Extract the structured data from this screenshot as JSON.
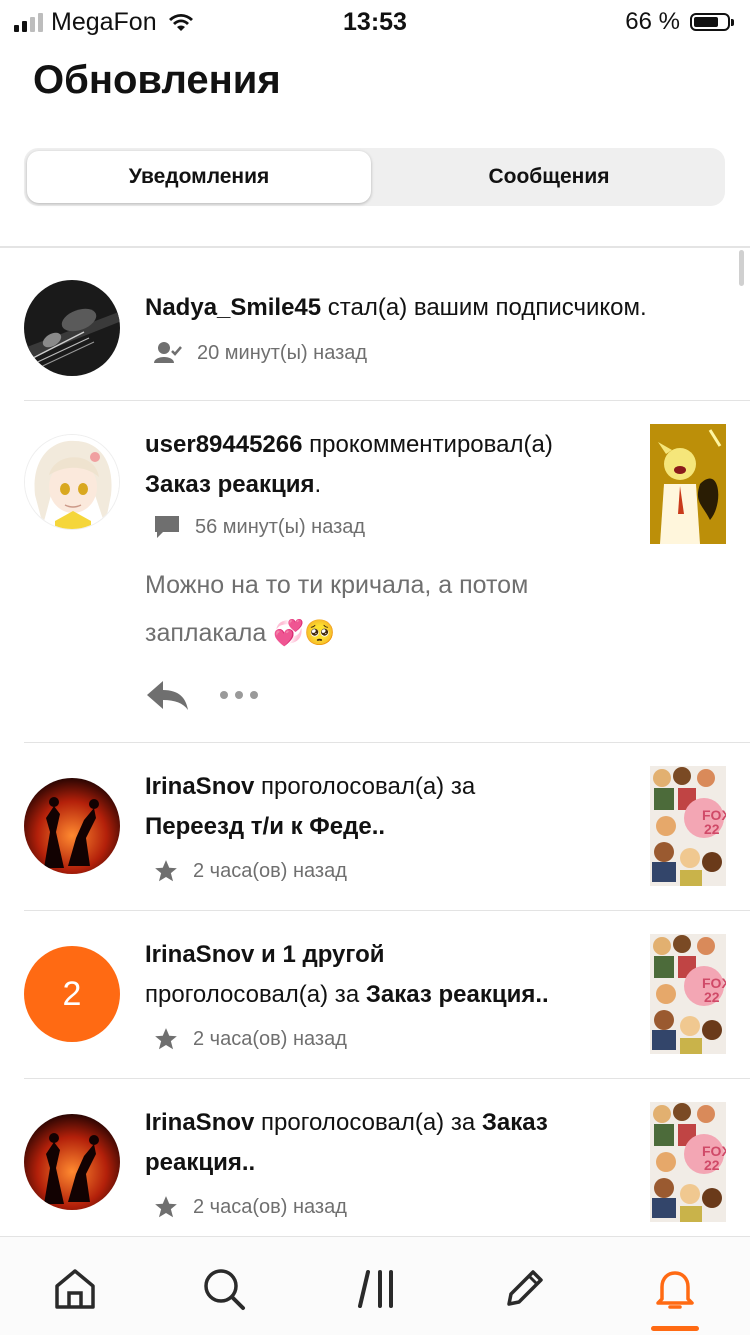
{
  "status_bar": {
    "carrier": "MegaFon",
    "time": "13:53",
    "battery": "66 %"
  },
  "page_title": "Обновления",
  "tabs": [
    {
      "label": "Уведомления",
      "active": true
    },
    {
      "label": "Сообщения",
      "active": false
    }
  ],
  "notifications": [
    {
      "user": "Nadya_Smile45",
      "action": " стал(а) вашим подписчиком.",
      "meta_icon": "follower-icon",
      "time": "20 минут(ы) назад"
    },
    {
      "user": "user89445266",
      "action": " прокомментировал(а)",
      "story": "Заказ реакция",
      "story_suffix": ".",
      "meta_icon": "comment-icon",
      "time": "56 минут(ы) назад",
      "comment_line1": "Можно на то ти кричала, а потом",
      "comment_line2": "заплакала 💞🥺"
    },
    {
      "user": "IrinaSnov",
      "action": " проголосовал(а) за",
      "story": "Переезд т/и к Феде..",
      "meta_icon": "star-icon",
      "time": "2 часа(ов) назад"
    },
    {
      "user": "IrinaSnov и 1 другой",
      "action": "проголосовал(а) за ",
      "story": "Заказ реакция..",
      "avatar_count": "2",
      "meta_icon": "star-icon",
      "time": "2 часа(ов) назад"
    },
    {
      "user": "IrinaSnov",
      "action": " проголосовал(а) за ",
      "story": "Заказ",
      "story_line2": "реакция..",
      "meta_icon": "star-icon",
      "time": "2 часа(ов) назад"
    }
  ],
  "bottom_nav": [
    {
      "icon": "home-icon"
    },
    {
      "icon": "search-icon"
    },
    {
      "icon": "library-icon"
    },
    {
      "icon": "write-icon"
    },
    {
      "icon": "bell-icon",
      "active": true
    }
  ],
  "colors": {
    "accent": "#ff6a13",
    "text": "#121212",
    "muted": "#6f6f6f"
  }
}
